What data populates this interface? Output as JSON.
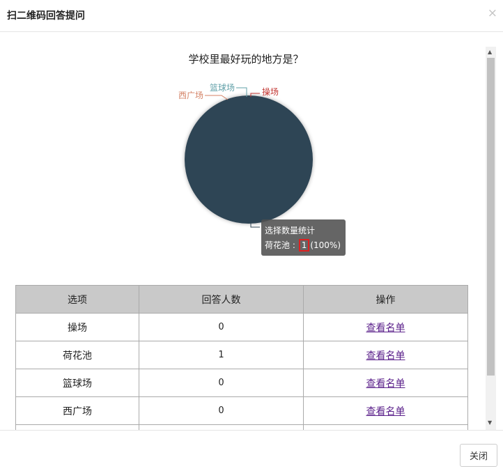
{
  "dialog": {
    "title": "扫二维码回答提问",
    "close_icon": "×",
    "footer_close": "关闭"
  },
  "question": {
    "title": "学校里最好玩的地方是？"
  },
  "chart_data": {
    "type": "pie",
    "categories": [
      "操场",
      "荷花池",
      "篮球场",
      "西广场"
    ],
    "values": [
      0,
      1,
      0,
      0
    ],
    "colors": [
      "#c23531",
      "#2f4554",
      "#61a0a8",
      "#d48265"
    ],
    "series_name": "选择数量统计"
  },
  "tooltip": {
    "series": "选择数量统计",
    "label": "荷花池 : ",
    "value": "1",
    "percent": "(100%)"
  },
  "table": {
    "headers": [
      "选项",
      "回答人数",
      "操作"
    ],
    "rows": [
      {
        "option": "操场",
        "count": "0",
        "action": "查看名单"
      },
      {
        "option": "荷花池",
        "count": "1",
        "action": "查看名单"
      },
      {
        "option": "篮球场",
        "count": "0",
        "action": "查看名单"
      },
      {
        "option": "西广场",
        "count": "0",
        "action": "查看名单"
      }
    ]
  },
  "icons": {
    "scroll_up": "up-arrow-icon",
    "scroll_down": "down-arrow-icon"
  }
}
